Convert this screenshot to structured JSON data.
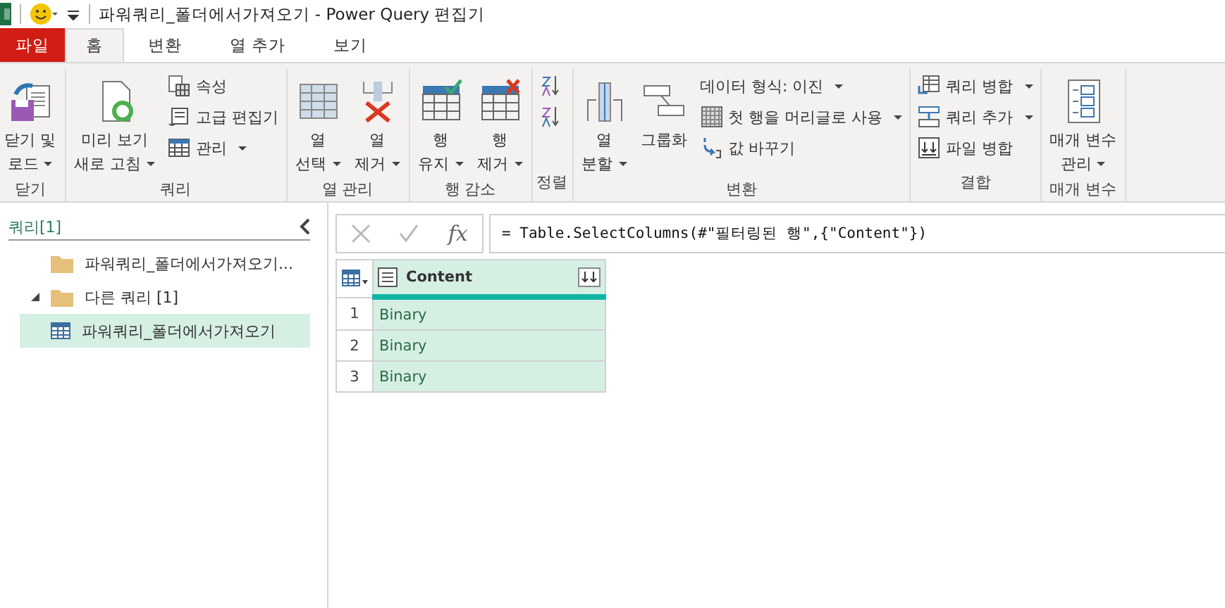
{
  "window": {
    "title": "파워쿼리_폴더에서가져오기 - Power Query 편집기"
  },
  "tabs": [
    {
      "label": "파일",
      "kind": "file",
      "selected": false
    },
    {
      "label": "홈",
      "kind": "tab",
      "selected": true
    },
    {
      "label": "변환",
      "kind": "tab",
      "selected": false
    },
    {
      "label": "열 추가",
      "kind": "tab",
      "selected": false
    },
    {
      "label": "보기",
      "kind": "tab",
      "selected": false
    }
  ],
  "ribbon": {
    "groups": [
      {
        "label": "닫기",
        "items": [
          {
            "kind": "large",
            "lines": [
              "닫기 및",
              "로드"
            ],
            "dropdown": true
          }
        ]
      },
      {
        "label": "쿼리",
        "items": [
          {
            "kind": "large",
            "lines": [
              "미리 보기",
              "새로 고침"
            ],
            "dropdown": true
          },
          {
            "kind": "stack",
            "items": [
              {
                "kind": "small",
                "label": "속성",
                "dropdown": false
              },
              {
                "kind": "small",
                "label": "고급 편집기",
                "dropdown": false
              },
              {
                "kind": "small",
                "label": "관리",
                "dropdown": true
              }
            ]
          }
        ]
      },
      {
        "label": "열 관리",
        "items": [
          {
            "kind": "large",
            "lines": [
              "열",
              "선택"
            ],
            "dropdown": true
          },
          {
            "kind": "large",
            "lines": [
              "열",
              "제거"
            ],
            "dropdown": true
          }
        ]
      },
      {
        "label": "행 감소",
        "items": [
          {
            "kind": "large",
            "lines": [
              "행",
              "유지"
            ],
            "dropdown": true
          },
          {
            "kind": "large",
            "lines": [
              "행",
              "제거"
            ],
            "dropdown": true
          }
        ]
      },
      {
        "label": "정렬",
        "items": [
          {
            "kind": "stack",
            "items": [
              {
                "kind": "icon"
              },
              {
                "kind": "icon"
              }
            ]
          }
        ]
      },
      {
        "label": "변환",
        "items": [
          {
            "kind": "large",
            "lines": [
              "열",
              "분할"
            ],
            "dropdown": true
          },
          {
            "kind": "large",
            "lines": [
              "그룹화"
            ],
            "dropdown": false
          },
          {
            "kind": "stack",
            "items": [
              {
                "kind": "text",
                "label": "데이터 형식: 이진",
                "dropdown": true
              },
              {
                "kind": "small",
                "label": "첫 행을 머리글로 사용",
                "dropdown": true
              },
              {
                "kind": "small",
                "label": "값 바꾸기",
                "dropdown": false
              }
            ]
          }
        ]
      },
      {
        "label": "결합",
        "items": [
          {
            "kind": "stack",
            "items": [
              {
                "kind": "small",
                "label": "쿼리 병합",
                "dropdown": true
              },
              {
                "kind": "small",
                "label": "쿼리 추가",
                "dropdown": true
              },
              {
                "kind": "small",
                "label": "파일 병합",
                "dropdown": false
              }
            ]
          }
        ]
      },
      {
        "label": "매개 변수",
        "items": [
          {
            "kind": "large",
            "lines": [
              "매개 변수",
              "관리"
            ],
            "dropdown": true
          }
        ]
      }
    ]
  },
  "queries_panel": {
    "title": "쿼리",
    "count": "[1]",
    "items": [
      {
        "kind": "folder",
        "label": "파워쿼리_폴더에서가져오기...",
        "expanded": false,
        "selected": false
      },
      {
        "kind": "folder",
        "label": "다른 쿼리 [1]",
        "expanded": true,
        "selected": false,
        "children": [
          {
            "kind": "query",
            "label": "파워쿼리_폴더에서가져오기",
            "selected": true
          }
        ]
      }
    ]
  },
  "formula_bar": {
    "fx": "fx",
    "formula": "= Table.SelectColumns(#\"필터링된 행\",{\"Content\"})"
  },
  "table": {
    "columns": [
      {
        "name": "Content"
      }
    ],
    "rows": [
      {
        "number": "1",
        "cells": [
          "Binary"
        ]
      },
      {
        "number": "2",
        "cells": [
          "Binary"
        ]
      },
      {
        "number": "3",
        "cells": [
          "Binary"
        ]
      }
    ]
  }
}
